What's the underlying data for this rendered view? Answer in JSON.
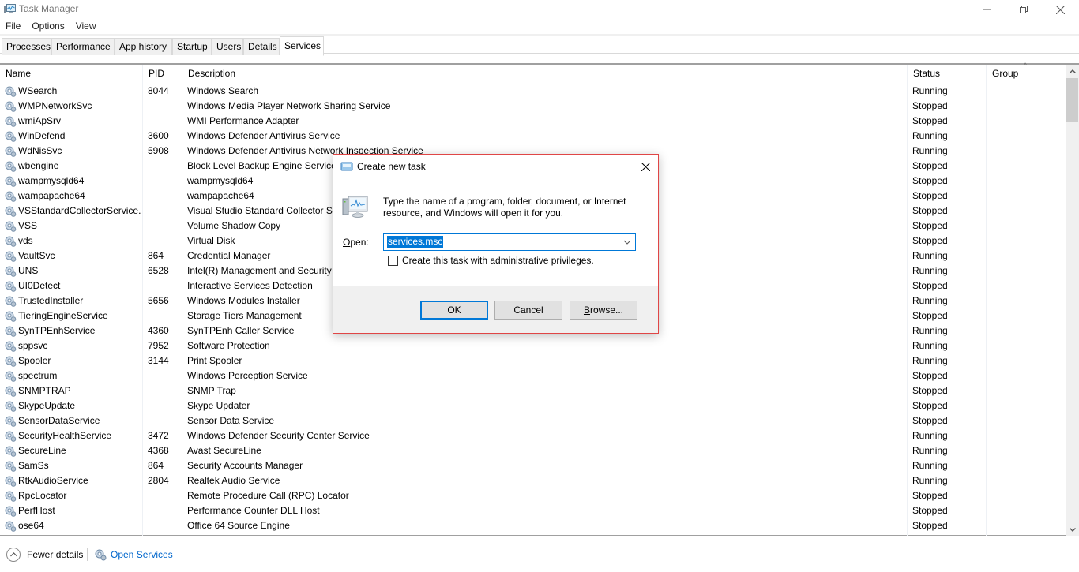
{
  "window": {
    "title": "Task Manager",
    "controls": {
      "minimize": "minimize",
      "maximize": "restore",
      "close": "close"
    }
  },
  "menu": [
    "File",
    "Options",
    "View"
  ],
  "tabs": [
    {
      "label": "Processes",
      "active": false
    },
    {
      "label": "Performance",
      "active": false
    },
    {
      "label": "App history",
      "active": false
    },
    {
      "label": "Startup",
      "active": false
    },
    {
      "label": "Users",
      "active": false
    },
    {
      "label": "Details",
      "active": false
    },
    {
      "label": "Services",
      "active": true
    }
  ],
  "table": {
    "columns": {
      "name": "Name",
      "pid": "PID",
      "description": "Description",
      "status": "Status",
      "group": "Group"
    },
    "sort_indicator": "^",
    "rows": [
      {
        "name": "WSearch",
        "pid": "8044",
        "description": "Windows Search",
        "status": "Running"
      },
      {
        "name": "WMPNetworkSvc",
        "pid": "",
        "description": "Windows Media Player Network Sharing Service",
        "status": "Stopped"
      },
      {
        "name": "wmiApSrv",
        "pid": "",
        "description": "WMI Performance Adapter",
        "status": "Stopped"
      },
      {
        "name": "WinDefend",
        "pid": "3600",
        "description": "Windows Defender Antivirus Service",
        "status": "Running"
      },
      {
        "name": "WdNisSvc",
        "pid": "5908",
        "description": "Windows Defender Antivirus Network Inspection Service",
        "status": "Running"
      },
      {
        "name": "wbengine",
        "pid": "",
        "description": "Block Level Backup Engine Service",
        "status": "Stopped"
      },
      {
        "name": "wampmysqld64",
        "pid": "",
        "description": "wampmysqld64",
        "status": "Stopped"
      },
      {
        "name": "wampapache64",
        "pid": "",
        "description": "wampapache64",
        "status": "Stopped"
      },
      {
        "name": "VSStandardCollectorService...",
        "pid": "",
        "description": "Visual Studio Standard Collector Service",
        "status": "Stopped"
      },
      {
        "name": "VSS",
        "pid": "",
        "description": "Volume Shadow Copy",
        "status": "Stopped"
      },
      {
        "name": "vds",
        "pid": "",
        "description": "Virtual Disk",
        "status": "Stopped"
      },
      {
        "name": "VaultSvc",
        "pid": "864",
        "description": "Credential Manager",
        "status": "Running"
      },
      {
        "name": "UNS",
        "pid": "6528",
        "description": "Intel(R) Management and Security Application User Notification Service",
        "status": "Running"
      },
      {
        "name": "UI0Detect",
        "pid": "",
        "description": "Interactive Services Detection",
        "status": "Stopped"
      },
      {
        "name": "TrustedInstaller",
        "pid": "5656",
        "description": "Windows Modules Installer",
        "status": "Running"
      },
      {
        "name": "TieringEngineService",
        "pid": "",
        "description": "Storage Tiers Management",
        "status": "Stopped"
      },
      {
        "name": "SynTPEnhService",
        "pid": "4360",
        "description": "SynTPEnh Caller Service",
        "status": "Running"
      },
      {
        "name": "sppsvc",
        "pid": "7952",
        "description": "Software Protection",
        "status": "Running"
      },
      {
        "name": "Spooler",
        "pid": "3144",
        "description": "Print Spooler",
        "status": "Running"
      },
      {
        "name": "spectrum",
        "pid": "",
        "description": "Windows Perception Service",
        "status": "Stopped"
      },
      {
        "name": "SNMPTRAP",
        "pid": "",
        "description": "SNMP Trap",
        "status": "Stopped"
      },
      {
        "name": "SkypeUpdate",
        "pid": "",
        "description": "Skype Updater",
        "status": "Stopped"
      },
      {
        "name": "SensorDataService",
        "pid": "",
        "description": "Sensor Data Service",
        "status": "Stopped"
      },
      {
        "name": "SecurityHealthService",
        "pid": "3472",
        "description": "Windows Defender Security Center Service",
        "status": "Running"
      },
      {
        "name": "SecureLine",
        "pid": "4368",
        "description": "Avast SecureLine",
        "status": "Running"
      },
      {
        "name": "SamSs",
        "pid": "864",
        "description": "Security Accounts Manager",
        "status": "Running"
      },
      {
        "name": "RtkAudioService",
        "pid": "2804",
        "description": "Realtek Audio Service",
        "status": "Running"
      },
      {
        "name": "RpcLocator",
        "pid": "",
        "description": "Remote Procedure Call (RPC) Locator",
        "status": "Stopped"
      },
      {
        "name": "PerfHost",
        "pid": "",
        "description": "Performance Counter DLL Host",
        "status": "Stopped"
      },
      {
        "name": "ose64",
        "pid": "",
        "description": "Office 64 Source Engine",
        "status": "Stopped"
      }
    ]
  },
  "footer": {
    "fewer_details_pre": "Fewer ",
    "fewer_details_mnemonic": "d",
    "fewer_details_post": "etails",
    "open_services": "Open Services"
  },
  "dialog": {
    "title": "Create new task",
    "message": "Type the name of a program, folder, document, or Internet resource, and Windows will open it for you.",
    "open_label_mnemonic": "O",
    "open_label_rest": "pen:",
    "open_value": "services.msc",
    "admin_checkbox_label": "Create this task with administrative privileges.",
    "admin_checked": false,
    "ok_label": "OK",
    "cancel_label": "Cancel",
    "browse_mnemonic": "B",
    "browse_rest": "rowse..."
  },
  "colors": {
    "accent": "#0078d7",
    "dialog_border": "#e04646",
    "link": "#0066cc"
  }
}
